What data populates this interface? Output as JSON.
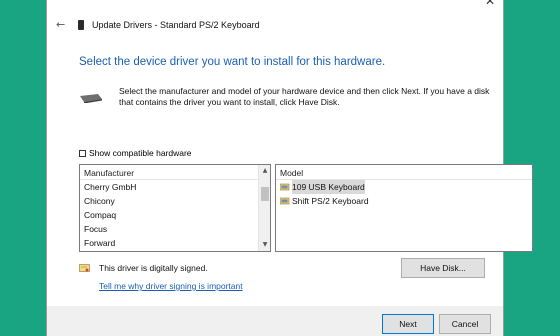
{
  "window": {
    "title": "Update Drivers - Standard PS/2 Keyboard",
    "close_glyph": "✕",
    "back_glyph": "←"
  },
  "main": {
    "heading": "Select the device driver you want to install for this hardware.",
    "description": "Select the manufacturer and model of your hardware device and then click Next. If you have a disk that contains the driver you want to install, click Have Disk.",
    "show_compatible_label": "Show compatible hardware",
    "show_compatible_checked": false
  },
  "manufacturer": {
    "header": "Manufacturer",
    "items": [
      "Cherry GmbH",
      "Chicony",
      "Compaq",
      "Focus",
      "Forward"
    ]
  },
  "model": {
    "header": "Model",
    "items": [
      {
        "label": "109 USB Keyboard",
        "selected": true
      },
      {
        "label": "Shift PS/2 Keyboard",
        "selected": false
      }
    ]
  },
  "signing": {
    "status_text": "This driver is digitally signed.",
    "link_text": "Tell me why driver signing is important"
  },
  "buttons": {
    "have_disk": "Have Disk...",
    "next": "Next",
    "cancel": "Cancel"
  },
  "scrollbar": {
    "up_glyph": "▲",
    "down_glyph": "▼"
  },
  "colors": {
    "desktop": "#1aa582",
    "accent": "#1a5fb4"
  }
}
